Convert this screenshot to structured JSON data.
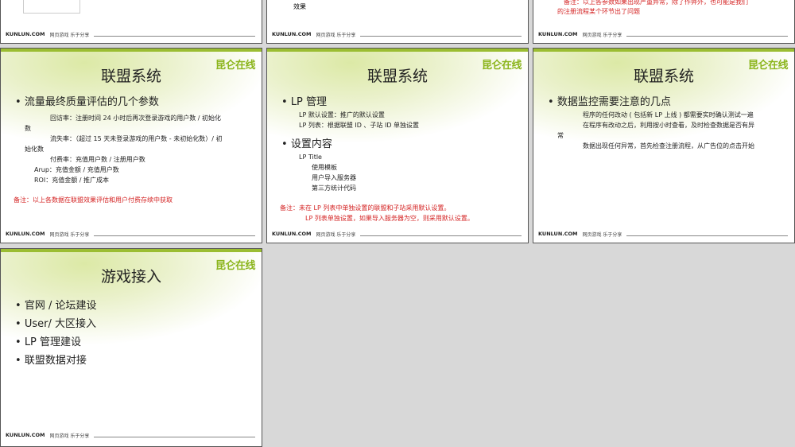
{
  "footer": {
    "brand": "KUNLUN.COM",
    "tagline": "网页游戏 乐于分享"
  },
  "logo": "昆仑在线",
  "top_row": {
    "left_logo_caption": "...",
    "middle_text": "效果",
    "right_note_line1": "备注：以上各参数如果出现严重异常，除了作弊外，也可能是我们",
    "right_note_line2": "的注册流程某个环节出了问题"
  },
  "slide1": {
    "title": "联盟系统",
    "heading": "流量最终质量评估的几个参数",
    "lines": [
      "回访率：注册时间 24 小时后再次登录游戏的用户数 / 初始化",
      "数",
      "流失率：（超过 15 天未登录游戏的用户数 - 未初始化数）/ 初",
      "始化数",
      "付费率：充值用户数 / 注册用户数",
      "Arup：充值金额 / 充值用户数",
      "ROI：充值金额 / 推广成本"
    ],
    "note": "备注：以上各数据在联盟效果评估和用户付费存续中获取"
  },
  "slide2": {
    "title": "联盟系统",
    "heading1": "LP 管理",
    "lines1": [
      "LP 默认设置：推广的默认设置",
      "LP 列表：根据联盟 ID 、子站 ID 单独设置"
    ],
    "heading2": "设置内容",
    "lp_title": "LP Title",
    "lines2": [
      "使用模板",
      "用户导入服务器",
      "第三方统计代码"
    ],
    "note1": "备注：未在 LP 列表中单独设置的联盟和子站采用默认设置。",
    "note2": "LP 列表单独设置，如果导入服务器为空，则采用默认设置。"
  },
  "slide3": {
    "title": "联盟系统",
    "heading": "数据监控需要注意的几点",
    "lines": [
      "程序的任何改动 ( 包括新 LP 上线 ) 都需要实时确认测试一遍",
      "在程序有改动之后，利用按小时查看，及时检查数据是否有异",
      "常",
      "数据出现任何异常，首先检查注册流程，从广告位的点击开始"
    ]
  },
  "slide4": {
    "title": "游戏接入",
    "items": [
      "官网 / 论坛建设",
      "User/ 大区接入",
      "LP 管理建设",
      "联盟数据对接"
    ]
  }
}
